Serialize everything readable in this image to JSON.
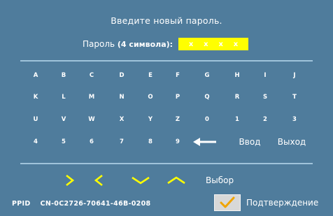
{
  "title": "Введите новый пароль.",
  "password": {
    "label_prefix": "Пароль ",
    "label_count": "(4 символа):",
    "chars": [
      "x",
      "x",
      "x",
      "x"
    ]
  },
  "keyboard": {
    "rows": [
      [
        "A",
        "B",
        "C",
        "D",
        "E",
        "F",
        "G",
        "H",
        "I",
        "J"
      ],
      [
        "K",
        "L",
        "M",
        "N",
        "O",
        "P",
        "Q",
        "R",
        "S",
        "T"
      ],
      [
        "U",
        "V",
        "W",
        "X",
        "Y",
        "Z",
        "0",
        "1",
        "2",
        "3"
      ],
      [
        "4",
        "5",
        "6",
        "7",
        "8",
        "9"
      ]
    ],
    "backspace_icon": "left-arrow-icon",
    "enter_label": "Ввод",
    "exit_label": "Выход"
  },
  "navigation": {
    "icons": [
      "chevron-right-icon",
      "chevron-left-icon",
      "chevron-down-icon",
      "chevron-up-icon"
    ],
    "select_label": "Выбор"
  },
  "footer": {
    "ppid_label": "PPID",
    "ppid_value": "CN-0C2726-70641-46B-0208",
    "confirm_icon": "checkmark-icon",
    "confirm_label": "Подтверждение"
  },
  "colors": {
    "background": "#4f7c9c",
    "password_box": "#ffff00",
    "nav_arrows": "#ffff00",
    "divider": "#9fc3da"
  }
}
